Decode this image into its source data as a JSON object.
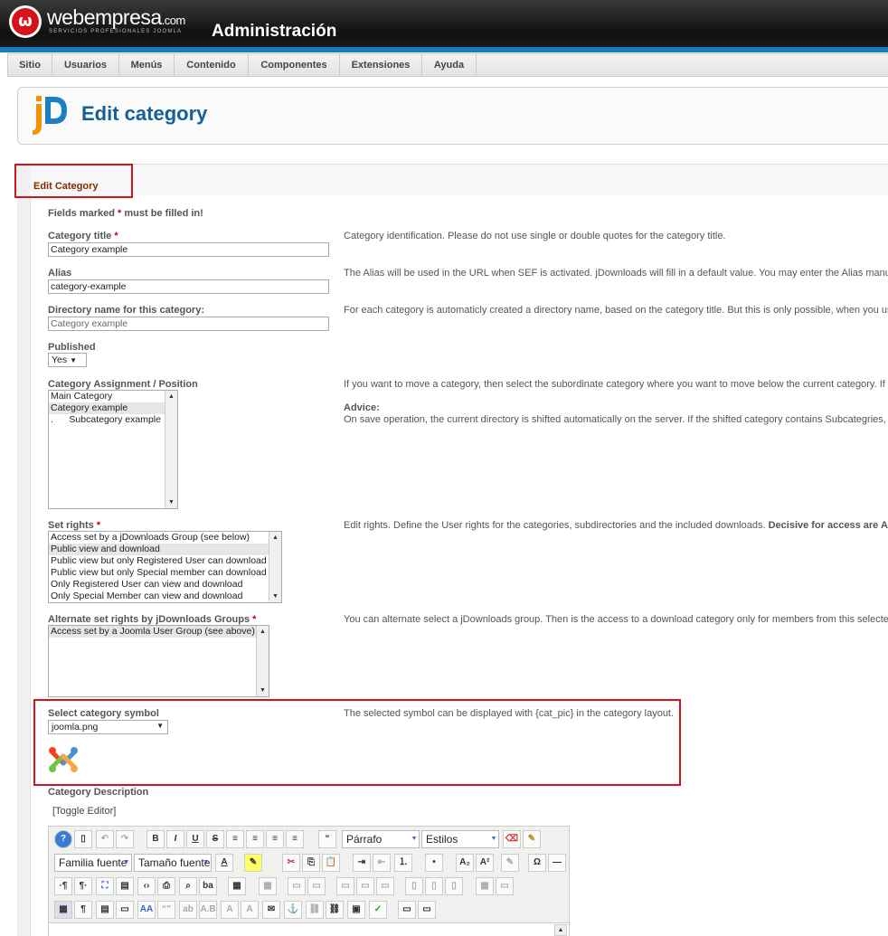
{
  "header": {
    "brand": "webempresa",
    "brand_suffix": ".com",
    "brand_sub": "SERVICIOS PROFESIONALES JOOMLA",
    "admin_title": "Administración"
  },
  "menu": [
    "Sitio",
    "Usuarios",
    "Menús",
    "Contenido",
    "Componentes",
    "Extensiones",
    "Ayuda"
  ],
  "page": {
    "title": "Edit category"
  },
  "form": {
    "legend": "Edit Category",
    "required_note_pre": "Fields marked ",
    "required_note_star": "*",
    "required_note_post": " must be filled in!",
    "category_title": {
      "label": "Category title ",
      "value": "Category example",
      "desc": "Category identification. Please do not use single or double quotes for the category title."
    },
    "alias": {
      "label": "Alias",
      "value": "category-example",
      "desc": "The Alias will be used in the URL when SEF is activated. jDownloads will fill in a default value. You may enter the Alias manua"
    },
    "directory": {
      "label": "Directory name for this category:",
      "value": "Category example",
      "desc": "For each category is automaticly created a directory name, based on the category title. But this is only possible, when you us"
    },
    "published": {
      "label": "Published",
      "value": "Yes"
    },
    "assignment": {
      "label": "Category Assignment / Position",
      "options": [
        "Main Category",
        "Category example",
        ".      Subcategory example"
      ],
      "selected": 1,
      "desc": "If you want to move a category, then select the subordinate category where you want to move below the current category. If",
      "advice_label": "Advice:",
      "advice": "On save operation, the current directory is shifted automatically on the server. If the shifted category contains Subcategries,"
    },
    "set_rights": {
      "label": "Set rights ",
      "options": [
        "Access set by a jDownloads Group (see below)",
        "Public view and download",
        "Public view but only Registered User can download",
        "Public view but only Special member can download",
        "Only Registered User can view and download",
        "Only Special Member can view and download"
      ],
      "selected": 1,
      "desc": "Edit rights. Define the User rights for the categories, subdirectories and the included downloads. ",
      "desc_bold": "Decisive for access are AL"
    },
    "alt_rights": {
      "label": "Alternate set rights by jDownloads Groups ",
      "options": [
        "Access set by a Joomla User Group (see above)"
      ],
      "selected": 0,
      "desc": "You can alternate select a jDownloads group. Then is the access to a download category only for members from this selecte"
    },
    "symbol": {
      "label": "Select category symbol",
      "value": "joomla.png",
      "desc": "The selected symbol can be displayed with {cat_pic} in the category layout."
    },
    "description": {
      "label": "Category Description",
      "toggle": "[Toggle Editor]"
    }
  },
  "editor": {
    "format_select": "Párrafo",
    "styles_select": "Estilos",
    "font_family": "Familia fuente",
    "font_size": "Tamaño fuente"
  },
  "colors": {
    "accent": "#146295",
    "menu_blue": "#1a7bc0",
    "highlight": "#d4141c",
    "legend": "#8b2a00"
  }
}
